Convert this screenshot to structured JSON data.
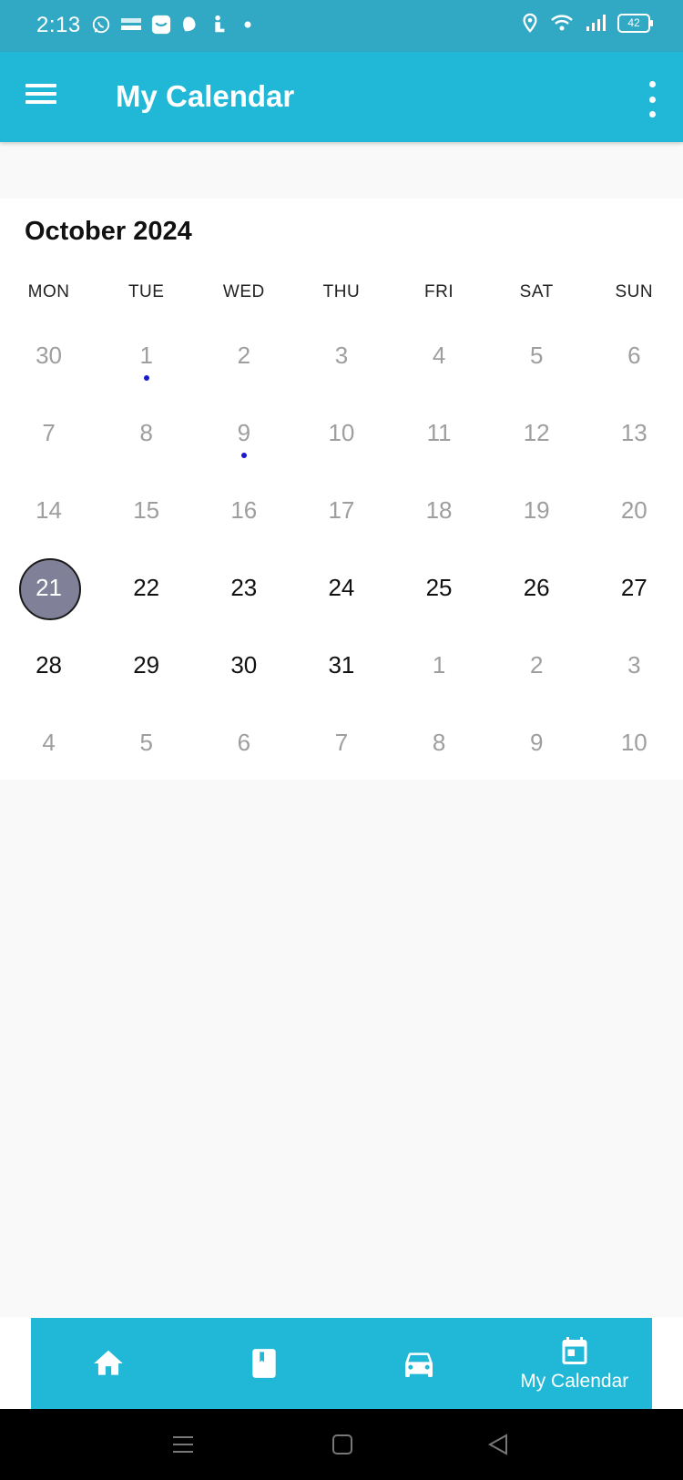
{
  "status_bar": {
    "time": "2:13",
    "battery": "42",
    "icons": [
      "whatsapp-icon",
      "temu-icon",
      "messenger-icon",
      "snapchat-icon",
      "accessibility-icon",
      "dot-icon",
      "location-icon",
      "wifi-icon",
      "signal-icon",
      "battery-icon"
    ]
  },
  "app_bar": {
    "title": "My Calendar",
    "icons": [
      "hamburger-menu-icon",
      "more-vert-icon"
    ],
    "color": "#20b8d6"
  },
  "calendar": {
    "month_label": "October 2024",
    "weekdays": [
      "MON",
      "TUE",
      "WED",
      "THU",
      "FRI",
      "SAT",
      "SUN"
    ],
    "weeks": [
      [
        {
          "d": "30",
          "cur": false
        },
        {
          "d": "1",
          "cur": false,
          "event": true
        },
        {
          "d": "2",
          "cur": false
        },
        {
          "d": "3",
          "cur": false
        },
        {
          "d": "4",
          "cur": false
        },
        {
          "d": "5",
          "cur": false
        },
        {
          "d": "6",
          "cur": false
        }
      ],
      [
        {
          "d": "7",
          "cur": false
        },
        {
          "d": "8",
          "cur": false
        },
        {
          "d": "9",
          "cur": false,
          "event": true
        },
        {
          "d": "10",
          "cur": false
        },
        {
          "d": "11",
          "cur": false
        },
        {
          "d": "12",
          "cur": false
        },
        {
          "d": "13",
          "cur": false
        }
      ],
      [
        {
          "d": "14",
          "cur": false
        },
        {
          "d": "15",
          "cur": false
        },
        {
          "d": "16",
          "cur": false
        },
        {
          "d": "17",
          "cur": false
        },
        {
          "d": "18",
          "cur": false
        },
        {
          "d": "19",
          "cur": false
        },
        {
          "d": "20",
          "cur": false
        }
      ],
      [
        {
          "d": "21",
          "cur": true,
          "selected": true
        },
        {
          "d": "22",
          "cur": true
        },
        {
          "d": "23",
          "cur": true
        },
        {
          "d": "24",
          "cur": true
        },
        {
          "d": "25",
          "cur": true
        },
        {
          "d": "26",
          "cur": true
        },
        {
          "d": "27",
          "cur": true
        }
      ],
      [
        {
          "d": "28",
          "cur": true
        },
        {
          "d": "29",
          "cur": true
        },
        {
          "d": "30",
          "cur": true
        },
        {
          "d": "31",
          "cur": true
        },
        {
          "d": "1",
          "cur": false
        },
        {
          "d": "2",
          "cur": false
        },
        {
          "d": "3",
          "cur": false
        }
      ],
      [
        {
          "d": "4",
          "cur": false
        },
        {
          "d": "5",
          "cur": false
        },
        {
          "d": "6",
          "cur": false
        },
        {
          "d": "7",
          "cur": false
        },
        {
          "d": "8",
          "cur": false
        },
        {
          "d": "9",
          "cur": false
        },
        {
          "d": "10",
          "cur": false
        }
      ]
    ],
    "colors": {
      "selected_fill": "#818099",
      "event_dot": "#1a1acc",
      "inactive_text": "#9e9e9e"
    }
  },
  "bottom_nav": {
    "items": [
      {
        "icon": "home-icon",
        "label": ""
      },
      {
        "icon": "bookmark-book-icon",
        "label": ""
      },
      {
        "icon": "car-icon",
        "label": ""
      },
      {
        "icon": "calendar-icon",
        "label": "My Calendar"
      }
    ]
  },
  "system_nav": {
    "icons": [
      "recent-apps-icon",
      "home-square-icon",
      "back-triangle-icon"
    ]
  }
}
